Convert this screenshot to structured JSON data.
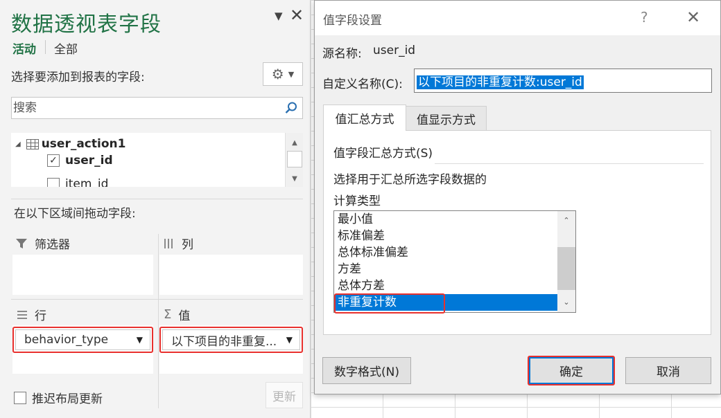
{
  "pane": {
    "title": "数据透视表字段",
    "tabs": {
      "active": "活动",
      "all": "全部"
    },
    "choose_label": "选择要添加到报表的字段:",
    "search": {
      "placeholder": "搜索",
      "value": ""
    },
    "table_name": "user_action1",
    "fields": [
      {
        "label": "user_id",
        "checked": true
      },
      {
        "label": "item_id",
        "checked": false
      }
    ],
    "drag_label": "在以下区域间拖动字段:",
    "areas": {
      "filters": "筛选器",
      "columns": "列",
      "rows": "行",
      "values": "值"
    },
    "row_field": "behavior_type",
    "value_field": "以下项目的非重复...",
    "defer_label": "推迟布局更新",
    "update_label": "更新",
    "icons": [
      "gear-icon",
      "search-icon",
      "table-icon",
      "filter-icon",
      "columns-icon",
      "rows-icon",
      "sigma-icon"
    ]
  },
  "dialog": {
    "title": "值字段设置",
    "help": "?",
    "source_label": "源名称:",
    "source_value": "user_id",
    "custom_name_label": "自定义名称(C):",
    "custom_name_value": "以下项目的非重复计数:user_id",
    "tabs": [
      "值汇总方式",
      "值显示方式"
    ],
    "summarize_label": "值字段汇总方式(S)",
    "description_line1": "选择用于汇总所选字段数据的",
    "description_line2": "计算类型",
    "options": [
      "最小值",
      "标准偏差",
      "总体标准偏差",
      "方差",
      "总体方差",
      "非重复计数"
    ],
    "selected_option": "非重复计数",
    "number_format_label": "数字格式(N)",
    "ok_label": "确定",
    "cancel_label": "取消"
  },
  "colors": {
    "brand_green": "#217346",
    "highlight_blue": "#0078d7",
    "annotation_red": "#e8302d"
  }
}
